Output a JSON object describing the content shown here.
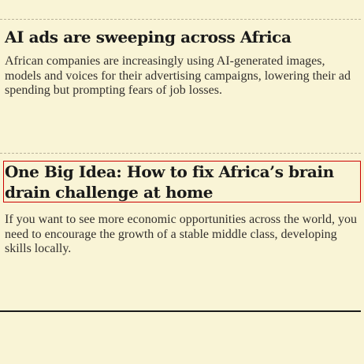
{
  "articles": [
    {
      "headline": "AI ads are sweeping across Africa",
      "standfirst": "African companies are increasingly using AI-generated images, models and voices for their advertising campaigns, lowering their ad spending but prompting fears of job losses."
    },
    {
      "headline": "One Big Idea: How to fix Africa’s brain drain challenge at home",
      "standfirst": "If you want to see more economic opportunities across the world, you need to encourage the growth of a stable middle class, developing skills locally."
    }
  ],
  "colors": {
    "background": "#f9f4d6",
    "text": "#1a1a1a",
    "focus_outline": "#cc0000"
  }
}
